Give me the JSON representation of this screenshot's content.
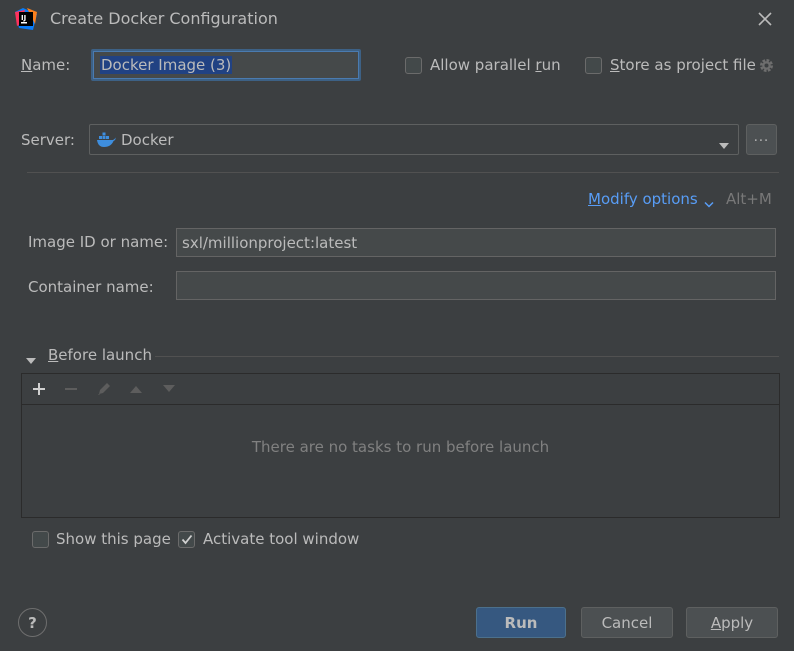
{
  "window": {
    "title": "Create Docker Configuration"
  },
  "name_row": {
    "label_mnemonic": "N",
    "label_rest": "ame:",
    "value": "Docker Image (3)"
  },
  "options": {
    "allow_parallel_pre": "Allow parallel ",
    "allow_parallel_mn": "r",
    "allow_parallel_post": "un",
    "allow_parallel_checked": false,
    "store_mn": "S",
    "store_rest": "tore as project file",
    "store_checked": false
  },
  "server": {
    "label": "Server:",
    "value": "Docker",
    "more_label": "..."
  },
  "modify": {
    "mn": "M",
    "rest": "odify options",
    "shortcut": "Alt+M"
  },
  "fields": {
    "image_label": "Image ID or name:",
    "image_value": "sxl/millionproject:latest",
    "container_label": "Container name:",
    "container_value": ""
  },
  "before_launch": {
    "mn": "B",
    "rest": "efore launch",
    "empty_message": "There are no tasks to run before launch"
  },
  "bottom_options": {
    "show_page": "Show this page",
    "show_page_checked": false,
    "activate_tool": "Activate tool window",
    "activate_tool_checked": true
  },
  "buttons": {
    "help": "?",
    "run": "Run",
    "cancel": "Cancel",
    "apply_mn": "A",
    "apply_rest": "pply"
  },
  "colors": {
    "background": "#3c3f41",
    "link": "#589df6",
    "primary_button": "#365880"
  }
}
